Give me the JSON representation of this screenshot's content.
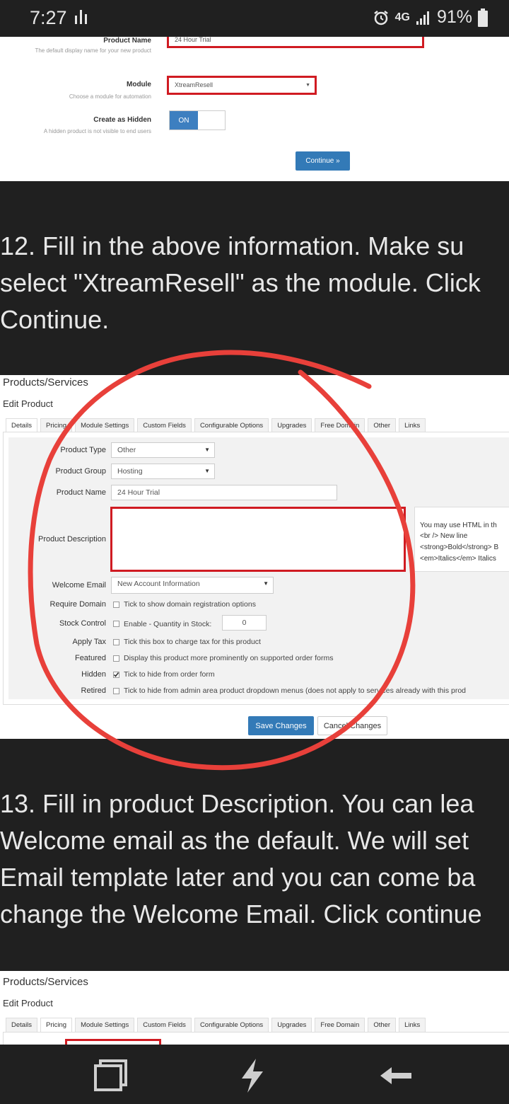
{
  "status_bar": {
    "time": "7:27",
    "network": "4G",
    "battery": "91%"
  },
  "screenshot_1": {
    "product_name": {
      "label": "Product Name",
      "help": "The default display name for your new product",
      "value": "24 Hour Trial"
    },
    "module": {
      "label": "Module",
      "help": "Choose a module for automation",
      "value": "XtreamResell"
    },
    "create_hidden": {
      "label": "Create as Hidden",
      "help": "A hidden product is not visible to end users",
      "toggle": "ON"
    },
    "continue_button": "Continue »"
  },
  "step_12": {
    "lines": [
      "12. Fill in the above information. Make su",
      "select \"XtreamResell\" as the module. Click",
      "Continue."
    ]
  },
  "screenshot_2": {
    "header": "Products/Services",
    "subheader": "Edit Product",
    "tabs": [
      "Details",
      "Pricing",
      "Module Settings",
      "Custom Fields",
      "Configurable Options",
      "Upgrades",
      "Free Domain",
      "Other",
      "Links"
    ],
    "rows": {
      "product_type": {
        "label": "Product Type",
        "value": "Other"
      },
      "product_group": {
        "label": "Product Group",
        "value": "Hosting"
      },
      "product_name": {
        "label": "Product Name",
        "value": "24 Hour Trial"
      },
      "product_description": {
        "label": "Product Description",
        "value": ""
      },
      "welcome_email": {
        "label": "Welcome Email",
        "value": "New Account Information"
      },
      "require_domain": {
        "label": "Require Domain",
        "text": "Tick to show domain registration options"
      },
      "stock_control": {
        "label": "Stock Control",
        "text": "Enable - Quantity in Stock:",
        "qty": "0"
      },
      "apply_tax": {
        "label": "Apply Tax",
        "text": "Tick this box to charge tax for this product"
      },
      "featured": {
        "label": "Featured",
        "text": "Display this product more prominently on supported order forms"
      },
      "hidden": {
        "label": "Hidden",
        "text": "Tick to hide from order form"
      },
      "retired": {
        "label": "Retired",
        "text": "Tick to hide from admin area product dropdown menus (does not apply to services already with this prod"
      }
    },
    "html_hint": [
      "You may use HTML in th",
      "<br /> New line",
      "<strong>Bold</strong> B",
      "<em>Italics</em> Italics"
    ],
    "save_button": "Save Changes",
    "cancel_button": "Cancel Changes"
  },
  "step_13": {
    "lines": [
      "13. Fill in product Description. You can lea",
      "Welcome email as the default. We will set",
      "Email template later and you can come ba",
      "change the Welcome Email. Click continue"
    ]
  },
  "screenshot_3": {
    "header": "Products/Services",
    "subheader": "Edit Product",
    "tabs": [
      "Details",
      "Pricing",
      "Module Settings",
      "Custom Fields",
      "Configurable Options",
      "Upgrades",
      "Free Domain",
      "Other",
      "Links"
    ]
  },
  "nav_bar": {
    "recents": "recent-apps-icon",
    "home": "bixby-lightning-icon",
    "back": "back-arrow-icon"
  },
  "colors": {
    "highlight_red": "#d01b22",
    "annotation_red": "#e8403a",
    "primary_blue": "#337ab7"
  }
}
